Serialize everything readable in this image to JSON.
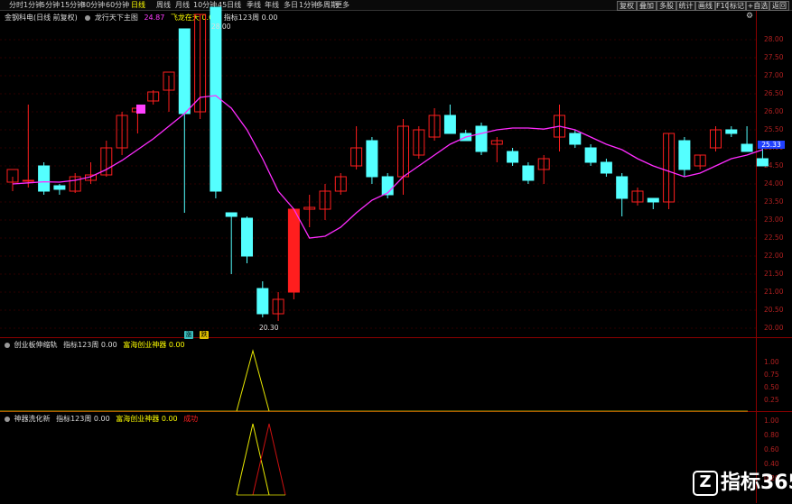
{
  "period_tabs": [
    "分时",
    "1分钟",
    "5分钟",
    "15分钟",
    "30分钟",
    "60分钟",
    "日线",
    "周线",
    "月线",
    "10分钟",
    "45日线",
    "季线",
    "年线",
    "多日",
    "1分钟",
    "多周期",
    "更多"
  ],
  "right_buttons": [
    "复权",
    "叠加",
    "多股",
    "统计",
    "画线",
    "F10",
    "标记",
    "+自选",
    "返回"
  ],
  "main_header": {
    "symbol": "金钢科电(日线 前复权)",
    "indicator": "龙行天下主图",
    "value1": "24.87",
    "label2": "飞龙在天",
    "value2": "0.00",
    "label3": "指标123周",
    "value3": "0.00"
  },
  "sub1_header": {
    "name": "创业板伸缩轨",
    "l1": "指标123周",
    "v1": "0.00",
    "l2": "富海创业神器",
    "v2": "0.00"
  },
  "sub2_header": {
    "name": "神器洗化新",
    "l1": "指标123周",
    "v1": "0.00",
    "l2": "富海创业神器",
    "v2": "0.00",
    "l3": "成功"
  },
  "annotations": {
    "high": "28.00",
    "low": "20.30"
  },
  "badges": [
    "涨",
    "跌"
  ],
  "price_label": "25.33",
  "watermark": "指标365",
  "sub_ticks": [
    "1.00",
    "0.75",
    "0.50",
    "0.25"
  ],
  "sub2_ticks": [
    "1.00",
    "0.80",
    "0.60",
    "0.40",
    "0.20"
  ],
  "colors": {
    "up": "#ff1e1e",
    "down": "#54ffff",
    "ma": "#ff2cff",
    "axis": "#8b0000",
    "signal_yellow": "#e8e800",
    "signal_red": "#cc1010",
    "tab_active": "#ffff00"
  },
  "chart_data": {
    "type": "candlestick",
    "y_range": [
      19.8,
      28.5
    ],
    "y_ticks": [
      "28.00",
      "27.50",
      "27.00",
      "26.50",
      "26.00",
      "25.50",
      "25.00",
      "24.50",
      "24.00",
      "23.50",
      "23.00",
      "22.50",
      "22.00",
      "21.50",
      "21.00",
      "20.50",
      "20.00"
    ],
    "candles": [
      {
        "o": 24.05,
        "h": 24.2,
        "l": 23.8,
        "c": 24.4,
        "d": false
      },
      {
        "o": 24.1,
        "h": 26.2,
        "l": 23.9,
        "c": 24.1,
        "d": false
      },
      {
        "o": 24.5,
        "h": 24.6,
        "l": 23.7,
        "c": 23.8,
        "d": true
      },
      {
        "o": 23.85,
        "h": 24.0,
        "l": 23.7,
        "c": 23.95,
        "d": true
      },
      {
        "o": 23.8,
        "h": 24.3,
        "l": 23.75,
        "c": 24.2,
        "d": false
      },
      {
        "o": 24.1,
        "h": 24.6,
        "l": 24.0,
        "c": 24.25,
        "d": false
      },
      {
        "o": 24.25,
        "h": 25.2,
        "l": 24.2,
        "c": 25.0,
        "d": false
      },
      {
        "o": 25.0,
        "h": 26.0,
        "l": 24.8,
        "c": 25.9,
        "d": false
      },
      {
        "o": 26.0,
        "h": 26.2,
        "l": 25.4,
        "c": 26.1,
        "d": false
      },
      {
        "o": 26.3,
        "h": 26.6,
        "l": 26.2,
        "c": 26.55,
        "d": false
      },
      {
        "o": 26.6,
        "h": 27.0,
        "l": 26.0,
        "c": 27.1,
        "d": false
      },
      {
        "o": 28.3,
        "h": 28.3,
        "l": 23.2,
        "c": 25.95,
        "d": true
      },
      {
        "o": 26.0,
        "h": 28.7,
        "l": 25.8,
        "c": 28.7,
        "d": false
      },
      {
        "o": 28.9,
        "h": 28.9,
        "l": 23.6,
        "c": 23.8,
        "d": true
      },
      {
        "o": 23.2,
        "h": 23.2,
        "l": 21.5,
        "c": 23.1,
        "d": true
      },
      {
        "o": 23.05,
        "h": 23.1,
        "l": 21.8,
        "c": 22.0,
        "d": true
      },
      {
        "o": 21.1,
        "h": 21.3,
        "l": 20.3,
        "c": 20.4,
        "d": true
      },
      {
        "o": 20.4,
        "h": 21.0,
        "l": 20.2,
        "c": 20.8,
        "d": false
      },
      {
        "o": 21.0,
        "h": 23.3,
        "l": 20.8,
        "c": 23.3,
        "d": false
      },
      {
        "o": 23.3,
        "h": 23.7,
        "l": 22.8,
        "c": 23.35,
        "d": false
      },
      {
        "o": 23.3,
        "h": 24.0,
        "l": 23.0,
        "c": 23.8,
        "d": false
      },
      {
        "o": 23.8,
        "h": 24.3,
        "l": 23.7,
        "c": 24.2,
        "d": false
      },
      {
        "o": 24.5,
        "h": 25.6,
        "l": 24.4,
        "c": 25.0,
        "d": false
      },
      {
        "o": 25.2,
        "h": 25.3,
        "l": 24.0,
        "c": 24.2,
        "d": true
      },
      {
        "o": 24.2,
        "h": 24.3,
        "l": 23.6,
        "c": 23.7,
        "d": true
      },
      {
        "o": 24.2,
        "h": 25.8,
        "l": 23.7,
        "c": 25.6,
        "d": false
      },
      {
        "o": 25.5,
        "h": 25.6,
        "l": 24.7,
        "c": 24.8,
        "d": false
      },
      {
        "o": 25.3,
        "h": 26.1,
        "l": 25.2,
        "c": 25.9,
        "d": false
      },
      {
        "o": 25.9,
        "h": 26.2,
        "l": 25.8,
        "c": 25.4,
        "d": true
      },
      {
        "o": 25.4,
        "h": 25.5,
        "l": 25.3,
        "c": 25.2,
        "d": true
      },
      {
        "o": 25.6,
        "h": 25.7,
        "l": 24.8,
        "c": 24.9,
        "d": true
      },
      {
        "o": 25.1,
        "h": 25.3,
        "l": 24.6,
        "c": 25.2,
        "d": false
      },
      {
        "o": 24.9,
        "h": 25.0,
        "l": 24.5,
        "c": 24.6,
        "d": true
      },
      {
        "o": 24.5,
        "h": 24.6,
        "l": 24.0,
        "c": 24.1,
        "d": true
      },
      {
        "o": 24.4,
        "h": 24.8,
        "l": 24.0,
        "c": 24.7,
        "d": false
      },
      {
        "o": 25.3,
        "h": 26.2,
        "l": 24.9,
        "c": 25.9,
        "d": false
      },
      {
        "o": 25.4,
        "h": 25.5,
        "l": 25.0,
        "c": 25.1,
        "d": true
      },
      {
        "o": 25.0,
        "h": 25.1,
        "l": 24.5,
        "c": 24.6,
        "d": true
      },
      {
        "o": 24.6,
        "h": 24.7,
        "l": 24.2,
        "c": 24.3,
        "d": true
      },
      {
        "o": 24.2,
        "h": 24.3,
        "l": 23.1,
        "c": 23.6,
        "d": true
      },
      {
        "o": 23.5,
        "h": 23.9,
        "l": 23.4,
        "c": 23.8,
        "d": false
      },
      {
        "o": 23.5,
        "h": 23.6,
        "l": 23.3,
        "c": 23.6,
        "d": true
      },
      {
        "o": 23.5,
        "h": 25.4,
        "l": 23.3,
        "c": 25.4,
        "d": false
      },
      {
        "o": 25.2,
        "h": 25.3,
        "l": 24.2,
        "c": 24.4,
        "d": true
      },
      {
        "o": 24.5,
        "h": 24.8,
        "l": 24.4,
        "c": 24.8,
        "d": false
      },
      {
        "o": 25.0,
        "h": 25.6,
        "l": 24.9,
        "c": 25.5,
        "d": false
      },
      {
        "o": 25.5,
        "h": 25.6,
        "l": 25.3,
        "c": 25.4,
        "d": true
      },
      {
        "o": 25.1,
        "h": 25.6,
        "l": 24.9,
        "c": 24.9,
        "d": true
      },
      {
        "o": 24.7,
        "h": 25.2,
        "l": 24.6,
        "c": 24.5,
        "d": true
      }
    ],
    "ma": [
      24.0,
      24.03,
      24.06,
      24.05,
      24.1,
      24.2,
      24.4,
      24.65,
      24.95,
      25.25,
      25.6,
      25.95,
      26.4,
      26.45,
      26.1,
      25.5,
      24.7,
      23.8,
      23.3,
      22.5,
      22.55,
      22.8,
      23.2,
      23.55,
      23.75,
      24.2,
      24.5,
      24.8,
      25.1,
      25.3,
      25.4,
      25.5,
      25.55,
      25.55,
      25.52,
      25.6,
      25.5,
      25.3,
      25.1,
      24.95,
      24.7,
      24.5,
      24.35,
      24.2,
      24.3,
      24.5,
      24.7,
      24.8,
      24.95
    ]
  }
}
